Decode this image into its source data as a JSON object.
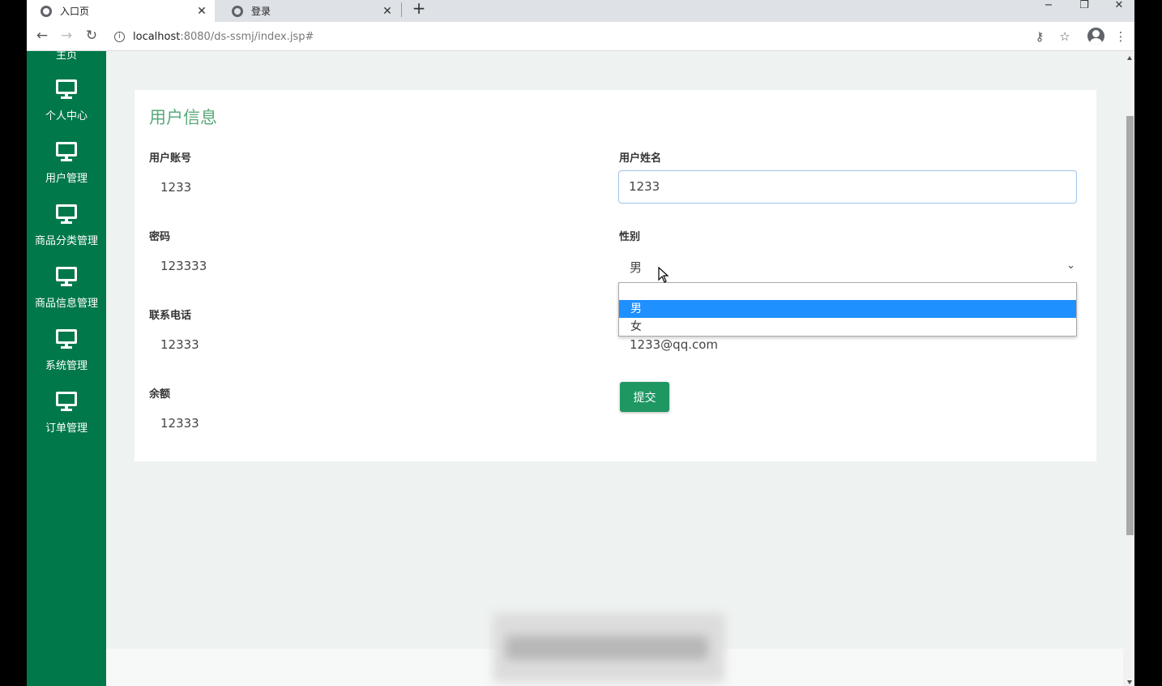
{
  "tabs": [
    {
      "title": "入口页",
      "active": true
    },
    {
      "title": "登录",
      "active": false
    }
  ],
  "window_controls": {
    "minimize": "−",
    "restore": "❐",
    "close": "✕"
  },
  "toolbar": {
    "url_host": "localhost",
    "url_path": ":8080/ds-ssmj/index.jsp#",
    "icons": [
      "back-arrow-icon",
      "forward-arrow-icon",
      "reload-icon",
      "info-icon",
      "key-icon",
      "star-icon",
      "profile-icon",
      "menu-dots-icon"
    ]
  },
  "sidebar": {
    "partial_label": "主页",
    "items": [
      {
        "label": "个人中心"
      },
      {
        "label": "用户管理"
      },
      {
        "label": "商品分类管理"
      },
      {
        "label": "商品信息管理"
      },
      {
        "label": "系统管理"
      },
      {
        "label": "订单管理"
      }
    ]
  },
  "form": {
    "title": "用户信息",
    "account_label": "用户账号",
    "account_value": "1233",
    "name_label": "用户姓名",
    "name_value": "1233",
    "password_label": "密码",
    "password_value": "123333",
    "gender_label": "性别",
    "gender_value": "男",
    "gender_options": [
      "男",
      "女"
    ],
    "phone_label": "联系电话",
    "phone_value": "12333",
    "email_value": "1233@qq.com",
    "balance_label": "余额",
    "balance_value": "12333",
    "submit_label": "提交"
  },
  "colors": {
    "sidebar_bg": "#00784a",
    "title_green": "#5aa97a",
    "submit_bg": "#1f9763",
    "option_highlight": "#1e90ff",
    "page_bg": "#eef2f1"
  }
}
